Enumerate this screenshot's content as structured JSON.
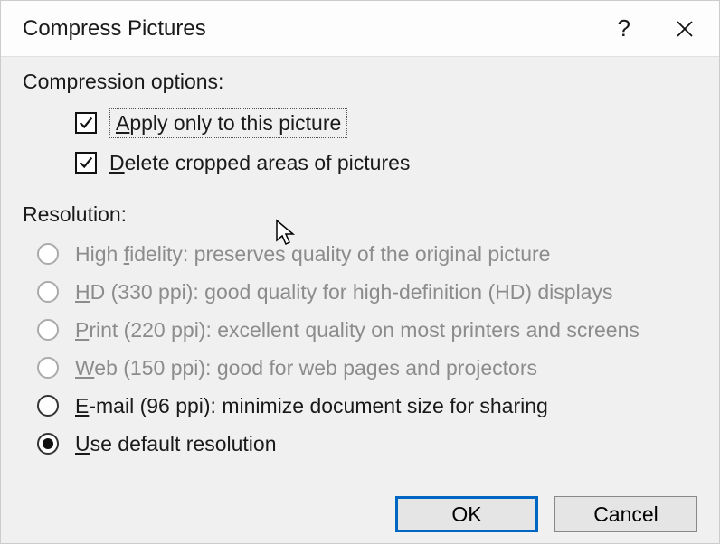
{
  "titlebar": {
    "title": "Compress Pictures"
  },
  "sections": {
    "compression_label": "Compression options:",
    "resolution_label": "Resolution:"
  },
  "compression_options": {
    "apply_only": {
      "prefix": "A",
      "rest": "pply only to this picture"
    },
    "delete_cropped": {
      "prefix": "D",
      "rest": "elete cropped areas of pictures"
    }
  },
  "resolution_options": {
    "high_fidelity": {
      "prefix": "High ",
      "under": "f",
      "rest": "idelity: preserves quality of the original picture"
    },
    "hd": {
      "under": "H",
      "rest": "D (330 ppi): good quality for high-definition (HD) displays"
    },
    "print": {
      "under": "P",
      "rest": "rint (220 ppi): excellent quality on most printers and screens"
    },
    "web": {
      "under": "W",
      "rest": "eb (150 ppi): good for web pages and projectors"
    },
    "email": {
      "under": "E",
      "rest": "-mail (96 ppi): minimize document size for sharing"
    },
    "default": {
      "under": "U",
      "rest": "se default resolution"
    }
  },
  "buttons": {
    "ok": "OK",
    "cancel": "Cancel"
  }
}
